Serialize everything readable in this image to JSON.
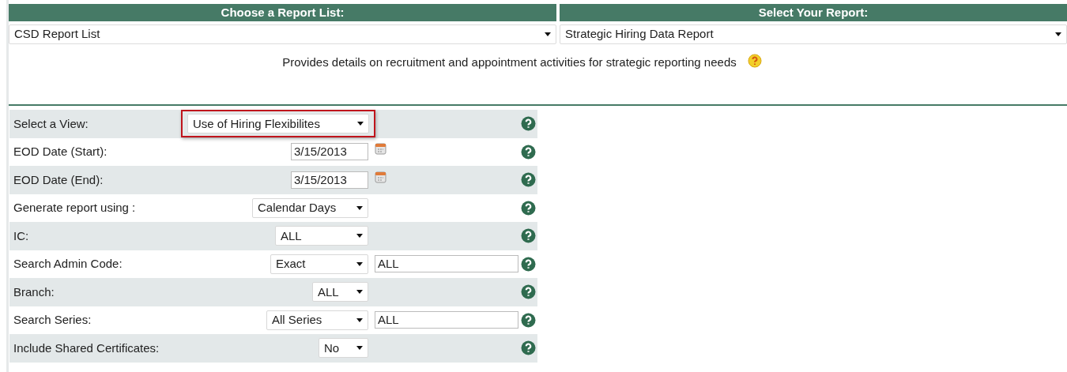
{
  "report_list": {
    "header": "Choose a Report List:",
    "value": "CSD Report List"
  },
  "report": {
    "header": "Select Your Report:",
    "value": "Strategic Hiring Data Report"
  },
  "description": "Provides details on recruitment and appointment activities for strategic reporting needs",
  "form_rows": [
    {
      "label": "Select a View:",
      "kind": "select",
      "value": "Use of Hiring Flexibilites",
      "highlighted": true
    },
    {
      "label": "EOD Date (Start):",
      "kind": "date",
      "value": "3/15/2013",
      "highlighted": false
    },
    {
      "label": "EOD Date (End):",
      "kind": "date",
      "value": "3/15/2013",
      "highlighted": false
    },
    {
      "label": "Generate report using :",
      "kind": "select",
      "value": "Calendar Days",
      "highlighted": false
    },
    {
      "label": "IC:",
      "kind": "select",
      "value": "ALL",
      "highlighted": false
    },
    {
      "label": "Search Admin Code:",
      "kind": "select_text",
      "value": "Exact",
      "text_value": "ALL",
      "highlighted": false
    },
    {
      "label": "Branch:",
      "kind": "select",
      "value": "ALL",
      "highlighted": false
    },
    {
      "label": "Search Series:",
      "kind": "select_text",
      "value": "All Series",
      "text_value": "ALL",
      "highlighted": false
    },
    {
      "label": "Include Shared Certificates:",
      "kind": "select",
      "value": "No",
      "highlighted": false
    }
  ]
}
